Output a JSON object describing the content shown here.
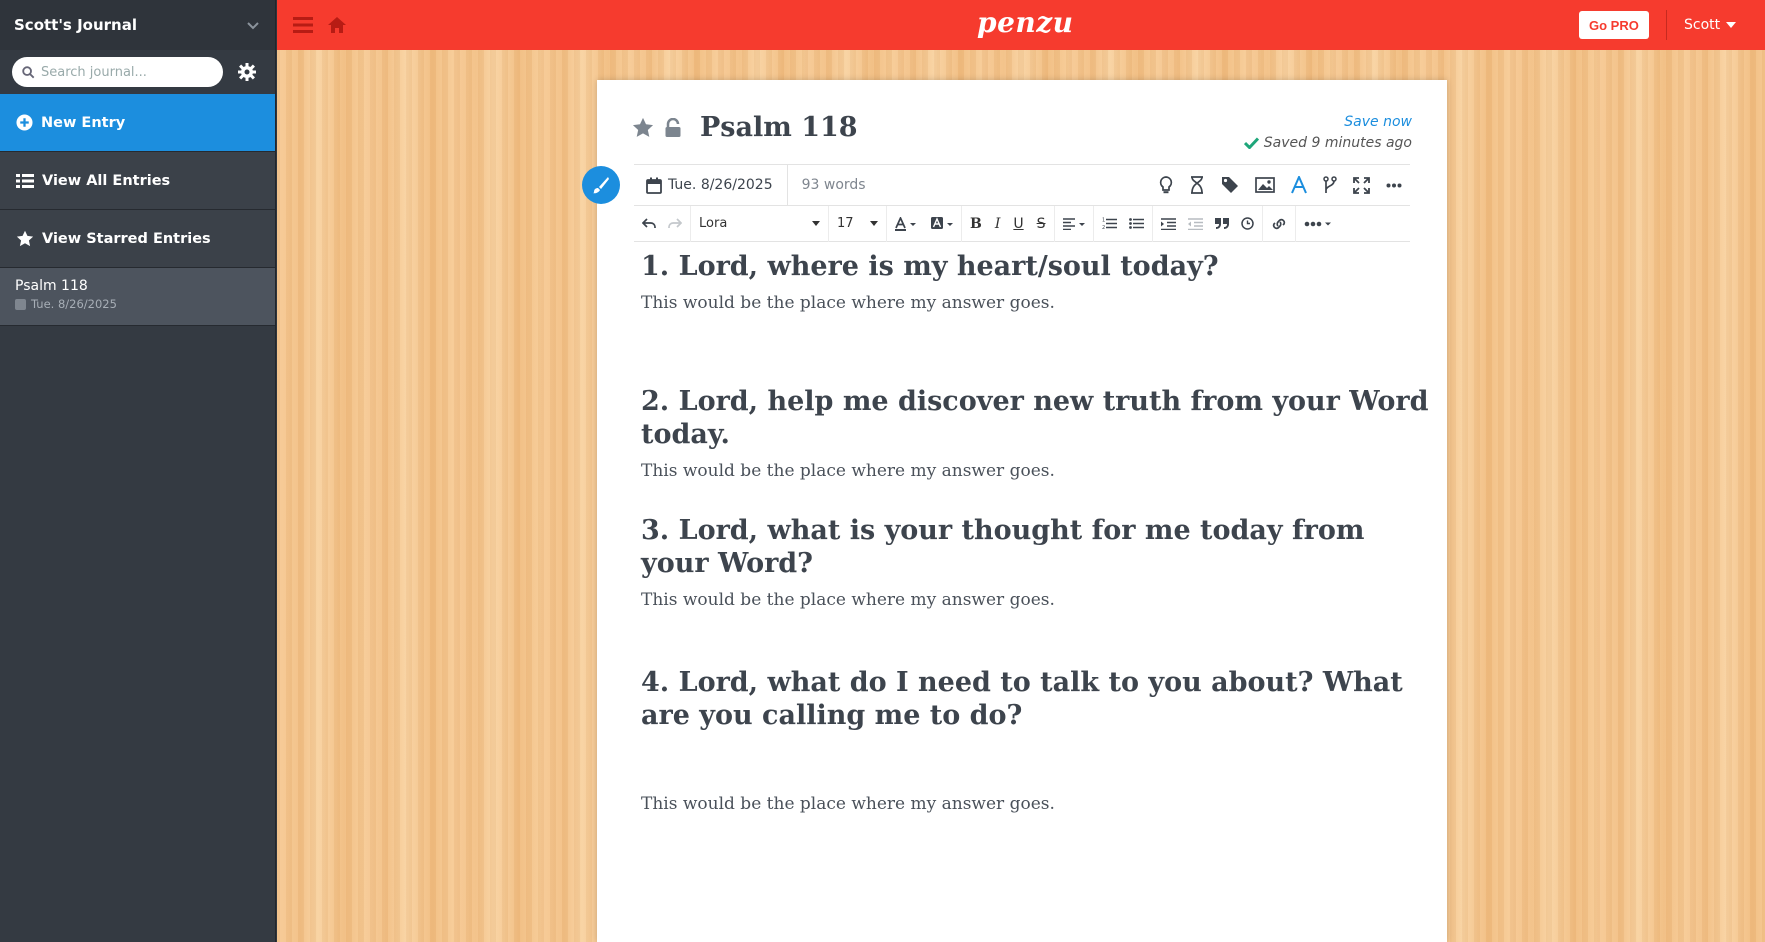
{
  "sidebar": {
    "journal_title": "Scott's Journal",
    "search_placeholder": "Search journal...",
    "nav": {
      "new_entry": "New Entry",
      "view_all": "View All Entries",
      "view_starred": "View Starred Entries"
    },
    "entries": [
      {
        "title": "Psalm 118",
        "date": "Tue. 8/26/2025"
      }
    ]
  },
  "topbar": {
    "logo": "penzu",
    "go_pro": "Go PRO",
    "user": "Scott"
  },
  "editor": {
    "title": "Psalm 118",
    "save_now": "Save now",
    "saved_status": "Saved 9 minutes ago",
    "date": "Tue. 8/26/2025",
    "word_count": "93 words",
    "font": "Lora",
    "font_size": "17",
    "accent_color": "#1c8ede"
  },
  "content": [
    {
      "question": "1.  Lord, where is my heart/soul today?",
      "answer": "This would be the place where my answer goes."
    },
    {
      "question": "2.  Lord, help me discover new truth from your Word today.",
      "answer": "This would be the place where my answer goes."
    },
    {
      "question": "3.  Lord, what is your thought for me today from your Word?",
      "answer": "This would be the place where my answer goes."
    },
    {
      "question": "4.  Lord, what do I need to talk to you about?  What are you calling me to do?",
      "answer": "This would be the place where my answer goes."
    }
  ]
}
